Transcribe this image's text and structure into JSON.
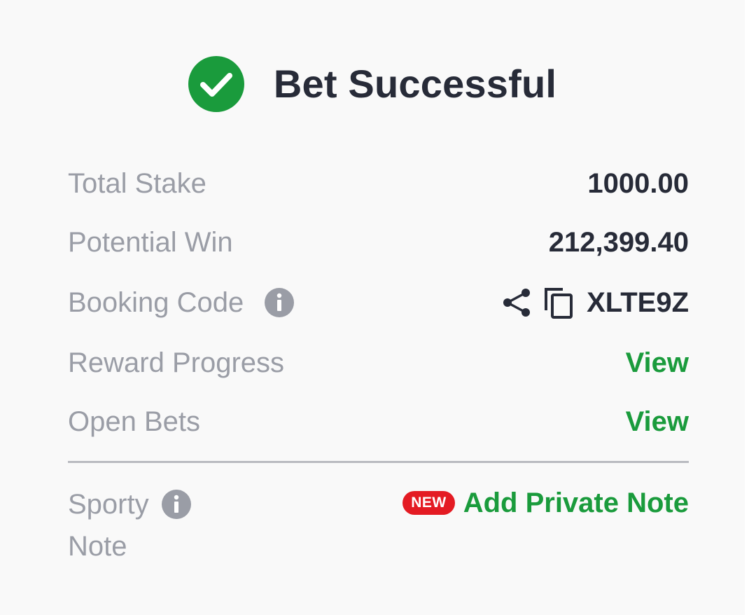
{
  "header": {
    "title": "Bet Successful",
    "status_icon": "check-circle-icon",
    "accent_color": "#1a9b3c"
  },
  "rows": {
    "total_stake": {
      "label": "Total Stake",
      "value": "1000.00"
    },
    "potential_win": {
      "label": "Potential Win",
      "value": "212,399.40"
    },
    "booking_code": {
      "label": "Booking Code",
      "value": "XLTE9Z",
      "info_icon": "info-icon",
      "share_icon": "share-icon",
      "copy_icon": "copy-icon"
    },
    "reward_progress": {
      "label": "Reward Progress",
      "action": "View"
    },
    "open_bets": {
      "label": "Open Bets",
      "action": "View"
    }
  },
  "note": {
    "label_line1": "Sporty",
    "label_line2": "Note",
    "badge": "NEW",
    "badge_color": "#e41b23",
    "action": "Add Private Note"
  }
}
